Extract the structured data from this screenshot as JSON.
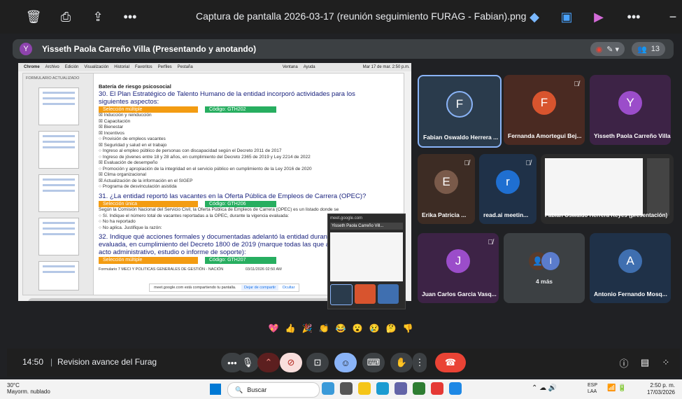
{
  "window": {
    "title": "Captura de pantalla 2026-03-17 (reunión seguimiento FURAG - Fabian).png",
    "icons": [
      "trash-icon",
      "print-icon",
      "share-icon",
      "more-icon",
      "copilot-icon",
      "edit-image-icon",
      "clipchamp-icon",
      "more-icon"
    ]
  },
  "presenter": {
    "initial": "Y",
    "label": "Yisseth Paola Carreño Villa (Presentando y anotando)",
    "count": "13"
  },
  "shared_screen": {
    "mac_menu": [
      "Chrome",
      "Archivo",
      "Edición",
      "Visualización",
      "Historial",
      "Favoritos",
      "Perfiles",
      "Pestaña",
      "Ventana",
      "Ayuda"
    ],
    "mac_clock": "Mar 17 de mar.  2:50 p.m.",
    "file_name": "FORMULARIO ACTUALIZADO",
    "doc_header": "Batería de riesgo psicosocial",
    "q30": "30. El Plan Estratégico de Talento Humano de la entidad incorporó actividades para los siguientes aspectos:",
    "q30_tag": "Selección múltiple",
    "q30_code": "Código: GTH202",
    "q30_options": [
      "Inducción y reinducción",
      "Capacitación",
      "Bienestar",
      "Incentivos",
      "Provisión de empleos vacantes",
      "Seguridad y salud en el trabajo",
      "Ingreso al empleo público de personas con discapacidad según el Decreto 2011 de 2017",
      "Ingreso de jóvenes entre 18 y 28 años, en cumplimiento del Decreto 2365 de 2019 y Ley 2214 de 2022",
      "Evaluación de desempeño",
      "Promoción y apropiación de la integridad en el servicio público en cumplimiento de la Ley 2016 de 2020",
      "Clima organizacional",
      "Actualización de la información en el SIGEP",
      "Programa de desvinculación asistida"
    ],
    "q31": "31. ¿La entidad reportó las vacantes en la Oferta Pública de Empleos de Carrera (OPEC)?",
    "q31_tag": "Selección única",
    "q31_code": "Código: GTH206",
    "q31_text": "Según la Comisión Nacional del Servicio Civil, la Oferta Pública de Empleos de Carrera (OPEC) es un listado donde se",
    "q31_options": [
      "Sí. Indique el número total de vacantes reportadas a la OPEC, durante la vigencia evaluada:",
      "No ha reportado",
      "No aplica. Justifique la razón:"
    ],
    "q32": "32. Indique qué acciones formales y documentadas adelantó la entidad durante la vigencia evaluada, en cumplimiento del Decreto 1800 de 2019 (marque todas las que apliquen y c con acto administrativo, estudio o informe de soporte):",
    "q32_tag": "Selección múltiple",
    "q32_code": "Código: GTH207",
    "footer_left": "Formulario 7 MECI Y POLITICAS GENERALES DE GESTIÓN - NACIÓN",
    "footer_date": "03/11/2026 02:50 AM",
    "sharing_notice": "meet.google.com está compartiendo tu pantalla.",
    "stop_sharing": "Dejar de compartir",
    "hide": "Ocultar"
  },
  "float_window": {
    "url": "meet.google.com",
    "presenter": "Yisseth Paola Carreño Vill..."
  },
  "participants": [
    {
      "initial": "F",
      "name": "Fabian Oswaldo Herrera ...",
      "bg": "#2a3b4c",
      "circle": "#3c4f63",
      "active": true,
      "muted": false
    },
    {
      "initial": "F",
      "name": "Fernanda Amortegui Bej...",
      "bg": "#4a2a22",
      "circle": "#d8542e",
      "active": false,
      "muted": true
    },
    {
      "initial": "Y",
      "name": "Yisseth Paola Carreño Villa",
      "bg": "#3d2346",
      "circle": "#9b4dca",
      "active": false,
      "muted": false
    },
    {
      "initial": "E",
      "name": "Erika Patricia ...",
      "bg": "#3d2c24",
      "circle": "#7a5a4a",
      "active": false,
      "muted": true
    },
    {
      "initial": "r",
      "name": "read.ai meetin...",
      "bg": "#1f3148",
      "circle": "#1f6fd1",
      "active": false,
      "muted": true
    },
    {
      "initial": "",
      "name": "Fabian Oswaldo Herrera Reyes (presentación)",
      "bg": "#2b2b2b",
      "circle": "",
      "active": false,
      "muted": false
    },
    {
      "initial": "J",
      "name": "Juan Carlos Garcia Vasq...",
      "bg": "#3d2346",
      "circle": "#9b4dca",
      "active": false,
      "muted": true
    },
    {
      "initial": "I",
      "name": "4 más",
      "bg": "#3c4043",
      "circle": "#5b7ccc",
      "active": false,
      "muted": false
    },
    {
      "initial": "A",
      "name": "Antonio Fernando Mosq...",
      "bg": "#1f3148",
      "circle": "#3f6fb0",
      "active": false,
      "muted": false
    }
  ],
  "reactions": [
    "heart",
    "thumbs-up",
    "party",
    "clap",
    "joy",
    "surprised",
    "sad",
    "thinking",
    "thumbs-down"
  ],
  "meeting": {
    "time": "14:50",
    "name": "Revision avance del Furag"
  },
  "controls": [
    "more-options",
    "microphone",
    "more-audio",
    "camera-off",
    "present",
    "emoji",
    "captions",
    "raise-hand",
    "more",
    "leave-call"
  ],
  "taskbar": {
    "temp": "30°C",
    "weather": "Mayorm. nublado",
    "search": "Buscar",
    "lang": "ESP",
    "lang2": "LAA",
    "clock": "2:50 p. m.",
    "date": "17/03/2026"
  }
}
